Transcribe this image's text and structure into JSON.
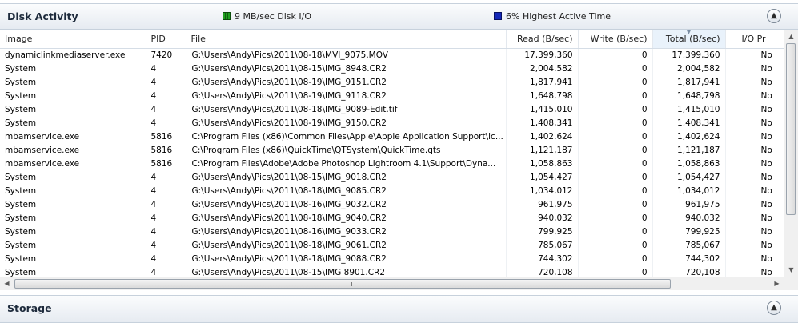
{
  "disk_panel": {
    "title": "Disk Activity",
    "io_stat": "9 MB/sec Disk I/O",
    "active_stat": "6% Highest Active Time",
    "io_color": "#1fa01f",
    "active_color": "#1428b8",
    "collapse_icon": "chevron-up-icon"
  },
  "table": {
    "columns": [
      "Image",
      "PID",
      "File",
      "Read (B/sec)",
      "Write (B/sec)",
      "Total (B/sec)",
      "I/O Pr"
    ],
    "sorted_column": "Total (B/sec)",
    "rows": [
      [
        "dynamiclinkmediaserver.exe",
        "7420",
        "G:\\Users\\Andy\\Pics\\2011\\08-18\\MVI_9075.MOV",
        "17,399,360",
        "0",
        "17,399,360",
        "No"
      ],
      [
        "System",
        "4",
        "G:\\Users\\Andy\\Pics\\2011\\08-15\\IMG_8948.CR2",
        "2,004,582",
        "0",
        "2,004,582",
        "No"
      ],
      [
        "System",
        "4",
        "G:\\Users\\Andy\\Pics\\2011\\08-19\\IMG_9151.CR2",
        "1,817,941",
        "0",
        "1,817,941",
        "No"
      ],
      [
        "System",
        "4",
        "G:\\Users\\Andy\\Pics\\2011\\08-19\\IMG_9118.CR2",
        "1,648,798",
        "0",
        "1,648,798",
        "No"
      ],
      [
        "System",
        "4",
        "G:\\Users\\Andy\\Pics\\2011\\08-18\\IMG_9089-Edit.tif",
        "1,415,010",
        "0",
        "1,415,010",
        "No"
      ],
      [
        "System",
        "4",
        "G:\\Users\\Andy\\Pics\\2011\\08-19\\IMG_9150.CR2",
        "1,408,341",
        "0",
        "1,408,341",
        "No"
      ],
      [
        "mbamservice.exe",
        "5816",
        "C:\\Program Files (x86)\\Common Files\\Apple\\Apple Application Support\\ic...",
        "1,402,624",
        "0",
        "1,402,624",
        "No"
      ],
      [
        "mbamservice.exe",
        "5816",
        "C:\\Program Files (x86)\\QuickTime\\QTSystem\\QuickTime.qts",
        "1,121,187",
        "0",
        "1,121,187",
        "No"
      ],
      [
        "mbamservice.exe",
        "5816",
        "C:\\Program Files\\Adobe\\Adobe Photoshop Lightroom 4.1\\Support\\Dyna...",
        "1,058,863",
        "0",
        "1,058,863",
        "No"
      ],
      [
        "System",
        "4",
        "G:\\Users\\Andy\\Pics\\2011\\08-15\\IMG_9018.CR2",
        "1,054,427",
        "0",
        "1,054,427",
        "No"
      ],
      [
        "System",
        "4",
        "G:\\Users\\Andy\\Pics\\2011\\08-18\\IMG_9085.CR2",
        "1,034,012",
        "0",
        "1,034,012",
        "No"
      ],
      [
        "System",
        "4",
        "G:\\Users\\Andy\\Pics\\2011\\08-16\\IMG_9032.CR2",
        "961,975",
        "0",
        "961,975",
        "No"
      ],
      [
        "System",
        "4",
        "G:\\Users\\Andy\\Pics\\2011\\08-18\\IMG_9040.CR2",
        "940,032",
        "0",
        "940,032",
        "No"
      ],
      [
        "System",
        "4",
        "G:\\Users\\Andy\\Pics\\2011\\08-16\\IMG_9033.CR2",
        "799,925",
        "0",
        "799,925",
        "No"
      ],
      [
        "System",
        "4",
        "G:\\Users\\Andy\\Pics\\2011\\08-18\\IMG_9061.CR2",
        "785,067",
        "0",
        "785,067",
        "No"
      ],
      [
        "System",
        "4",
        "G:\\Users\\Andy\\Pics\\2011\\08-18\\IMG_9088.CR2",
        "744,302",
        "0",
        "744,302",
        "No"
      ],
      [
        "System",
        "4",
        "G:\\Users\\Andy\\Pics\\2011\\08-15\\IMG 8901.CR2",
        "720,108",
        "0",
        "720,108",
        "No"
      ]
    ]
  },
  "storage_panel": {
    "title": "Storage",
    "collapse_icon": "chevron-up-icon"
  }
}
